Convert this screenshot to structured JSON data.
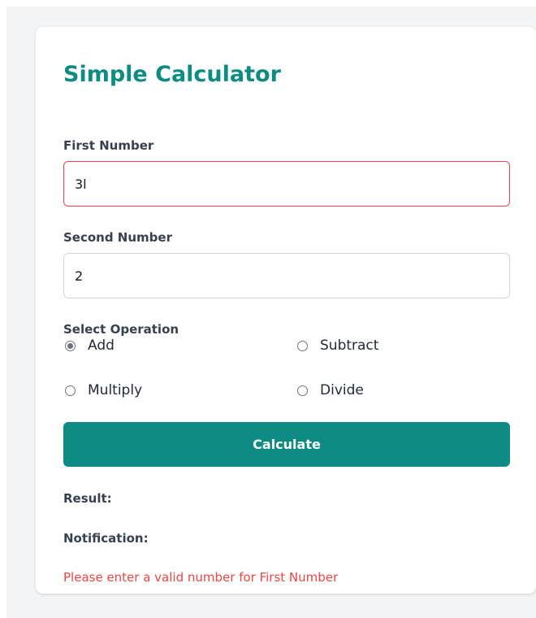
{
  "calculator": {
    "title": "Simple Calculator",
    "first_number": {
      "label": "First Number",
      "value": "3l",
      "has_error": true
    },
    "second_number": {
      "label": "Second Number",
      "value": "2"
    },
    "operation": {
      "label": "Select Operation",
      "options": [
        {
          "label": "Add",
          "checked": true
        },
        {
          "label": "Subtract",
          "checked": false
        },
        {
          "label": "Multiply",
          "checked": false
        },
        {
          "label": "Divide",
          "checked": false
        }
      ]
    },
    "calculate_label": "Calculate",
    "result_label": "Result:",
    "notification_label": "Notification:",
    "error_message": "Please enter a valid number for First Number"
  },
  "colors": {
    "accent": "#0e8c84",
    "error": "#ef4444",
    "page_background": "#f3f4f6"
  }
}
